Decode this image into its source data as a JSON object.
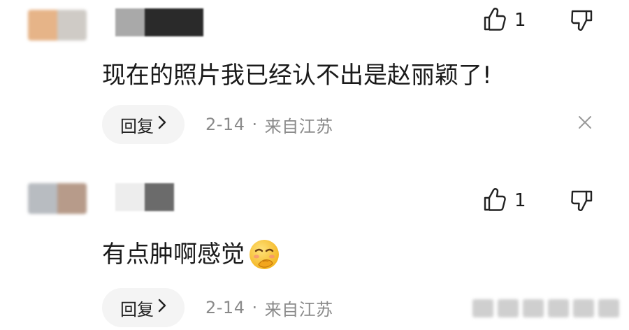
{
  "comments": [
    {
      "text": "现在的照片我已经认不出是赵丽颖了!",
      "likes": "1",
      "reply_label": "回复",
      "date": "2-14",
      "separator": "·",
      "location": "来自江苏",
      "avatar_colors": [
        "#e6b488",
        "#cfcbc6"
      ],
      "username_colors": [
        "#a9a9a9",
        "#2a2a2a",
        "#2a2a2a"
      ]
    },
    {
      "text": "有点肿啊感觉",
      "likes": "1",
      "reply_label": "回复",
      "date": "2-14",
      "separator": "·",
      "location": "来自江苏",
      "avatar_colors": [
        "#b8bcc1",
        "#b79b8a"
      ],
      "username_colors": [
        "#ededed",
        "#6b6b6b"
      ]
    }
  ],
  "icons": {
    "like": "thumbs-up-icon",
    "dislike": "thumbs-down-icon",
    "chevron": "chevron-right-icon",
    "close": "close-icon",
    "emoji": "smirk-emoji-icon"
  },
  "colors": {
    "text": "#1a1a1a",
    "meta": "#8a8a8a",
    "reply_bg": "#f4f4f4",
    "icon": "#222222"
  }
}
